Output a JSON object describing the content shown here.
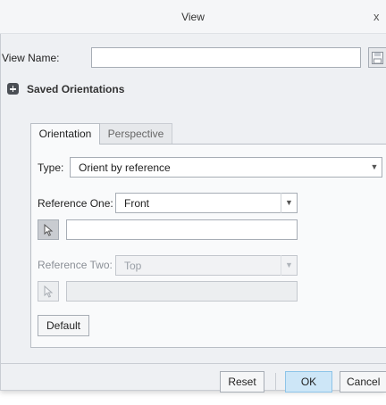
{
  "window": {
    "title": "View",
    "close_glyph": "x"
  },
  "view_name": {
    "label": "View Name:",
    "value": "",
    "save_icon": "save-disk-icon"
  },
  "saved_orientations": {
    "label": "Saved Orientations",
    "icon": "expand-plus-icon"
  },
  "tabs": [
    {
      "label": "Orientation",
      "active": true
    },
    {
      "label": "Perspective",
      "active": false
    }
  ],
  "orientation": {
    "type_label": "Type:",
    "type_value": "Orient by reference",
    "reference_one": {
      "label": "Reference One:",
      "value": "Front",
      "field_value": "",
      "enabled": true
    },
    "reference_two": {
      "label": "Reference Two:",
      "value": "Top",
      "field_value": "",
      "enabled": false
    },
    "default_label": "Default"
  },
  "footer": {
    "reset_label": "Reset",
    "ok_label": "OK",
    "cancel_label": "Cancel"
  },
  "colors": {
    "accent_ok": "#cde6f7",
    "window_bg": "#eef0f3"
  }
}
